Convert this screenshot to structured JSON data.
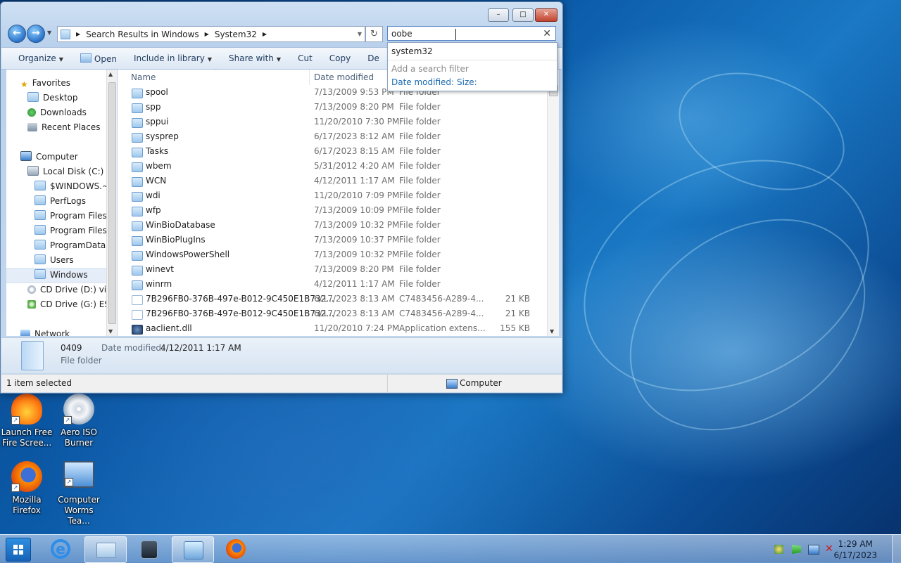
{
  "window": {
    "breadcrumb": [
      "Search Results in Windows",
      "System32"
    ],
    "search_value": "oobe",
    "buttons": {
      "minimize": "–",
      "maximize": "□",
      "close": "✕"
    }
  },
  "toolbar": {
    "organize": "Organize",
    "open": "Open",
    "include": "Include in library",
    "share": "Share with",
    "cut": "Cut",
    "copy": "Copy",
    "delete": "De"
  },
  "search_dropdown": {
    "suggestion": "system32",
    "filter_hint": "Add a search filter",
    "filter_date": "Date modified:",
    "filter_size": "Size:"
  },
  "nav_pane": {
    "favorites": "Favorites",
    "desktop": "Desktop",
    "downloads": "Downloads",
    "recent": "Recent Places",
    "computer": "Computer",
    "local_disk": "Local Disk (C:)",
    "windows_bt": "$WINDOWS.~B",
    "perflogs": "PerfLogs",
    "program_files": "Program Files",
    "program_files_x86": "Program Files (",
    "programdata": "ProgramData",
    "users": "Users",
    "windows": "Windows",
    "cd_d": "CD Drive (D:) virt",
    "cd_g": "CD Drive (G:) ESD",
    "network": "Network"
  },
  "columns": {
    "name": "Name",
    "date": "Date modified"
  },
  "files": [
    {
      "name": "spool",
      "date": "7/13/2009 9:53 PM",
      "type": "File folder",
      "size": ""
    },
    {
      "name": "spp",
      "date": "7/13/2009 8:20 PM",
      "type": "File folder",
      "size": ""
    },
    {
      "name": "sppui",
      "date": "11/20/2010 7:30 PM",
      "type": "File folder",
      "size": ""
    },
    {
      "name": "sysprep",
      "date": "6/17/2023 8:12 AM",
      "type": "File folder",
      "size": ""
    },
    {
      "name": "Tasks",
      "date": "6/17/2023 8:15 AM",
      "type": "File folder",
      "size": ""
    },
    {
      "name": "wbem",
      "date": "5/31/2012 4:20 AM",
      "type": "File folder",
      "size": ""
    },
    {
      "name": "WCN",
      "date": "4/12/2011 1:17 AM",
      "type": "File folder",
      "size": ""
    },
    {
      "name": "wdi",
      "date": "11/20/2010 7:09 PM",
      "type": "File folder",
      "size": ""
    },
    {
      "name": "wfp",
      "date": "7/13/2009 10:09 PM",
      "type": "File folder",
      "size": ""
    },
    {
      "name": "WinBioDatabase",
      "date": "7/13/2009 10:32 PM",
      "type": "File folder",
      "size": ""
    },
    {
      "name": "WinBioPlugIns",
      "date": "7/13/2009 10:37 PM",
      "type": "File folder",
      "size": ""
    },
    {
      "name": "WindowsPowerShell",
      "date": "7/13/2009 10:32 PM",
      "type": "File folder",
      "size": ""
    },
    {
      "name": "winevt",
      "date": "7/13/2009 8:20 PM",
      "type": "File folder",
      "size": ""
    },
    {
      "name": "winrm",
      "date": "4/12/2011 1:17 AM",
      "type": "File folder",
      "size": ""
    },
    {
      "name": "7B296FB0-376B-497e-B012-9C450E1B732...",
      "date": "6/17/2023 8:13 AM",
      "type": "C7483456-A289-4...",
      "size": "21 KB"
    },
    {
      "name": "7B296FB0-376B-497e-B012-9C450E1B732...",
      "date": "6/17/2023 8:13 AM",
      "type": "C7483456-A289-4...",
      "size": "21 KB"
    },
    {
      "name": "aaclient.dll",
      "date": "11/20/2010 7:24 PM",
      "type": "Application extens...",
      "size": "155 KB"
    }
  ],
  "details": {
    "name": "0409",
    "date_label": "Date modified:",
    "date_value": "4/12/2011 1:17 AM",
    "type": "File folder"
  },
  "status": {
    "selected": "1 item selected",
    "location": "Computer"
  },
  "desktop_icons": [
    {
      "line1": "Launch Free",
      "line2": "Fire Scree..."
    },
    {
      "line1": "Aero ISO",
      "line2": "Burner"
    },
    {
      "line1": "Mozilla",
      "line2": "Firefox"
    },
    {
      "line1": "Computer",
      "line2": "Worms Tea..."
    }
  ],
  "clock": {
    "time": "1:29 AM",
    "date": "6/17/2023"
  }
}
